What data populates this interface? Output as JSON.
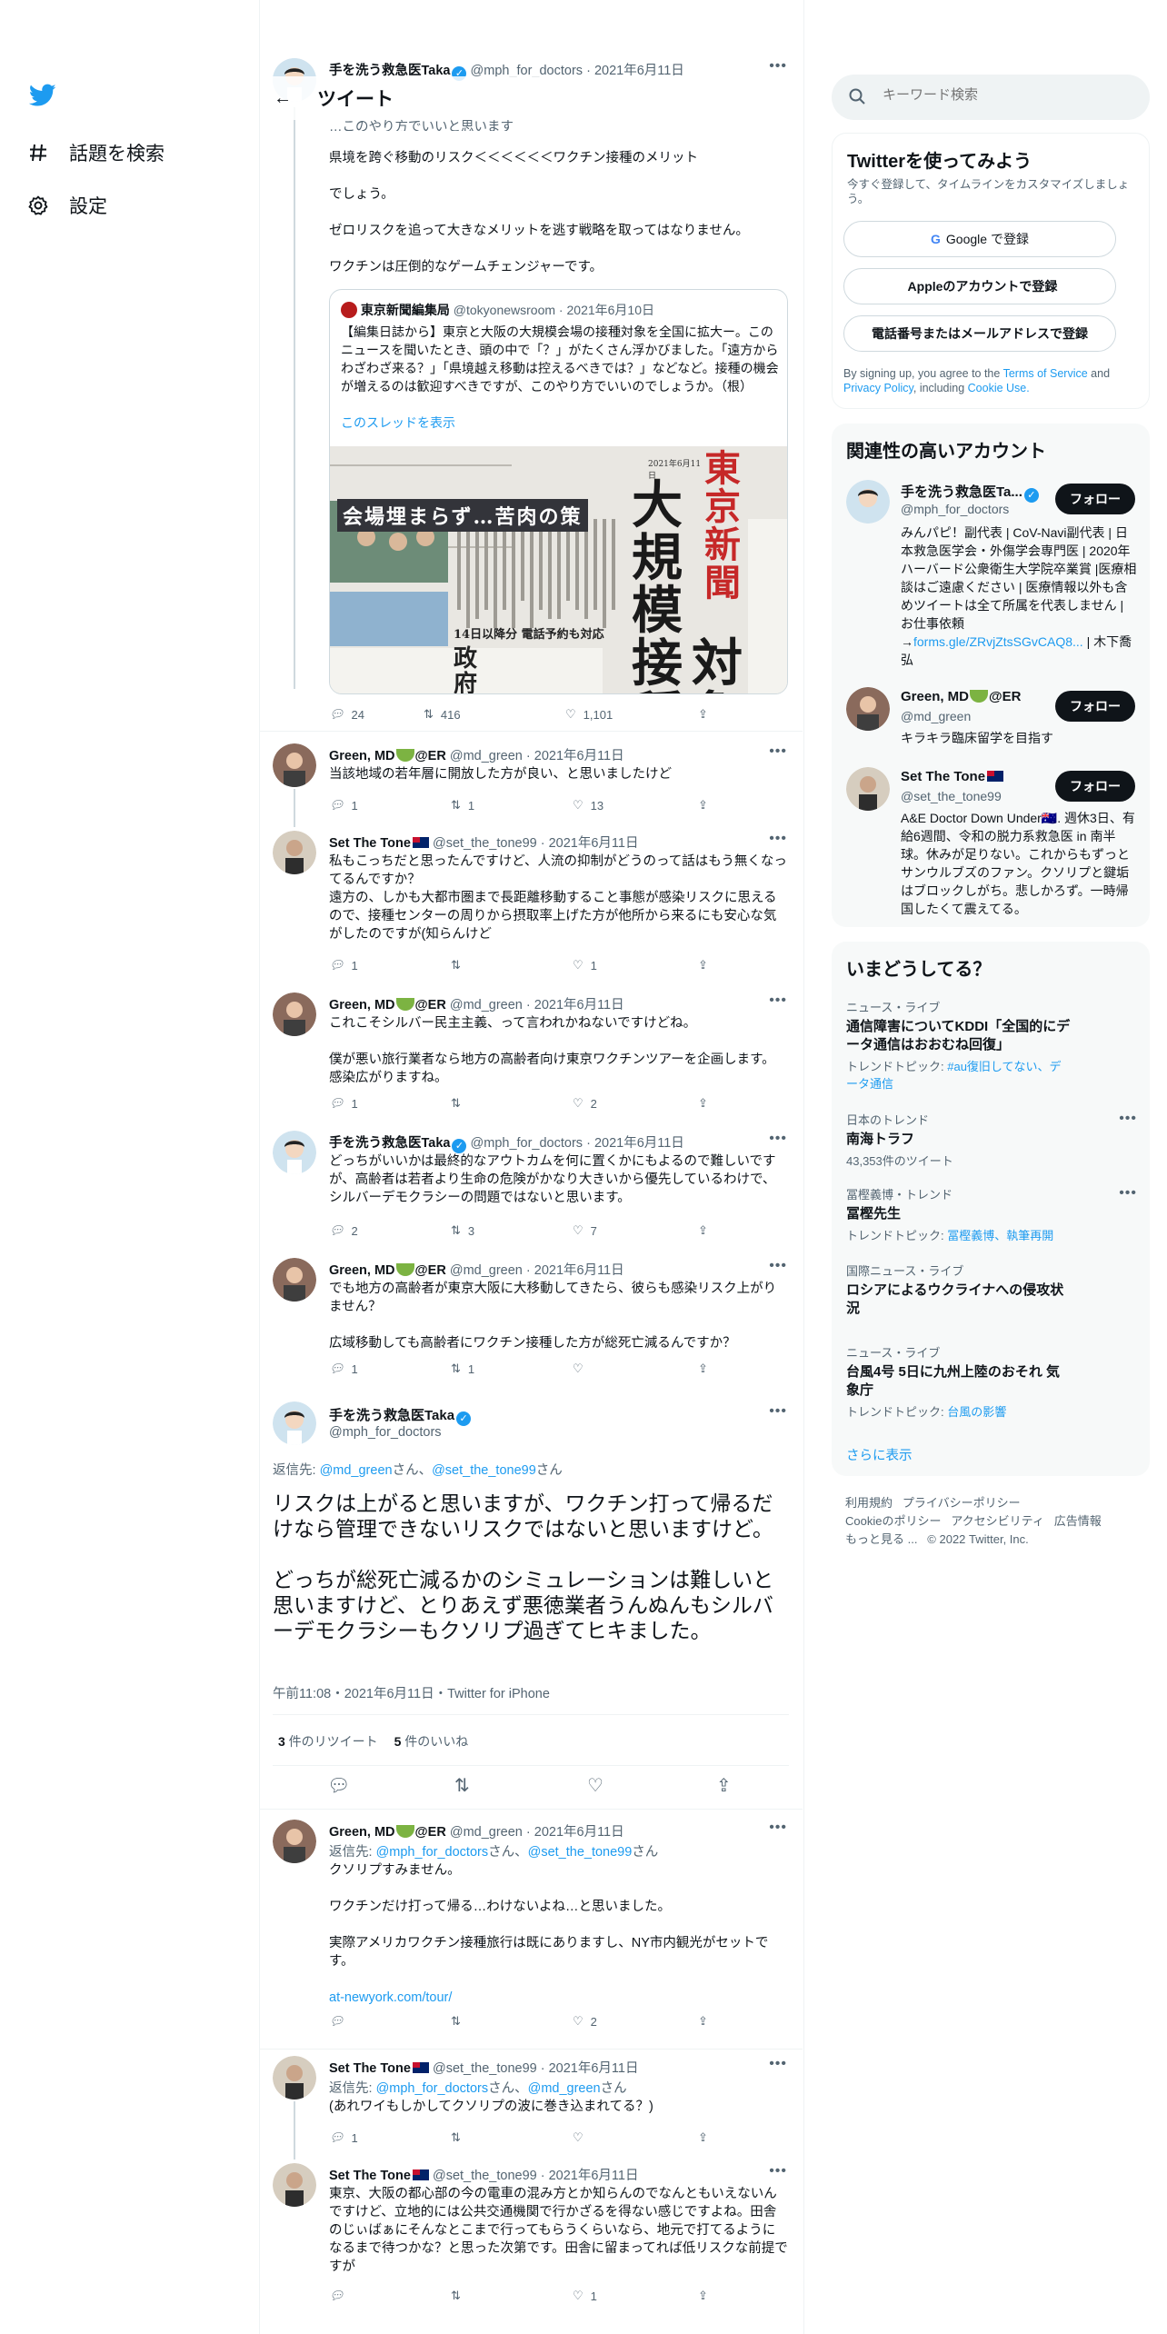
{
  "nav": {
    "explore": "話題を検索",
    "settings": "設定"
  },
  "header": {
    "title": "ツイート"
  },
  "search": {
    "placeholder": "キーワード検索"
  },
  "signup": {
    "title": "Twitterを使ってみよう",
    "subtitle": "今すぐ登録して、タイムラインをカスタマイズしましょう。",
    "google": "Google で登録",
    "apple": "Appleのアカウントで登録",
    "phone": "電話番号またはメールアドレスで登録",
    "terms_pre": "By signing up, you agree to the ",
    "terms_link": "Terms of Service",
    "terms_mid": " and ",
    "privacy_link": "Privacy Policy",
    "terms_mid2": ", including ",
    "cookie_link": "Cookie Use."
  },
  "related": {
    "title": "関連性の高いアカウント",
    "follow": "フォロー",
    "accounts": [
      {
        "name": "手を洗う救急医Ta...",
        "handle": "@mph_for_doctors",
        "bio": "みんパピ！副代表 | CoV-Navi副代表 | 日本救急医学会・外傷学会専門医 | 2020年ハーバード公衆衛生大学院卒業賞 |医療相談はご遠慮ください | 医療情報以外も含めツイートは全て所属を代表しません | お仕事依頼→",
        "bio_link": "forms.gle/ZRvjZtsSGvCAQ8...",
        "bio_end": " | 木下喬弘"
      },
      {
        "name": "Green, MD",
        "name2": "@ER",
        "handle": "@md_green",
        "bio": "キラキラ臨床留学を目指す"
      },
      {
        "name": "Set The Tone",
        "handle": "@set_the_tone99",
        "bio": "A&E Doctor Down Under🇦🇺. 週休3日、有給6週間、令和の脱力系救急医 in 南半球。休みが足りない。これからもずっとサンウルブズのファン。クソリプと鍵垢はブロックしがち。悲しかろず。一時帰国したくて震えてる。"
      }
    ]
  },
  "trends": {
    "title": "いまどうしてる？",
    "items": [
      {
        "cat": "ニュース・ライブ",
        "name": "通信障害についてKDDI「全国的にデータ通信はおおむね回復」",
        "sub_pre": "トレンドトピック: ",
        "sub_link": "#au復旧してない、データ通信"
      },
      {
        "cat": "日本のトレンド",
        "name": "南海トラフ",
        "sub": "43,353件のツイート"
      },
      {
        "cat": "冨樫義博・トレンド",
        "name": "冨樫先生",
        "sub_pre": "トレンドトピック: ",
        "sub_link": "冨樫義博、執筆再開"
      },
      {
        "cat": "国際ニュース・ライブ",
        "name": "ロシアによるウクライナへの侵攻状況"
      },
      {
        "cat": "ニュース・ライブ",
        "name": "台風4号 5日に九州上陸のおそれ 気象庁",
        "sub_pre": "トレンドトピック: ",
        "sub_link": "台風の影響"
      }
    ],
    "show_more": "さらに表示"
  },
  "footer": {
    "l1": "利用規約",
    "l2": "プライバシーポリシー",
    "l3": "Cookieのポリシー",
    "l4": "アクセシビリティ",
    "l5": "広告情報",
    "l6": "もっと見る ...",
    "copy": "© 2022 Twitter, Inc."
  },
  "top_tweet": {
    "name": "手を洗う救急医Taka",
    "handle": "@mph_for_doctors",
    "date": "2021年6月11日",
    "partial": "…このやり方でいいと思います",
    "text": "県境を跨ぐ移動のリスク＜＜＜＜＜＜ワクチン接種のメリット\n\nでしょう。\n\nゼロリスクを追って大きなメリットを逃す戦略を取ってはなりません。\n\nワクチンは圧倒的なゲームチェンジャーです。",
    "quote": {
      "name": "東京新聞編集局",
      "handle": "@tokyonewsroom",
      "date": "2021年6月10日",
      "text": "【編集日誌から】東京と大阪の大規模会場の接種対象を全国に拡大ー。このニュースを聞いたとき、頭の中で「？」がたくさん浮かびました。「遠方からわざわざ来る？」「県境越え移動は控えるべきでは？」などなど。接種の機会が増えるのは歓迎すべきですが、このやり方でいいのでしょうか。（根）",
      "thread": "このスレッドを表示",
      "paper_name": "東京新聞",
      "headline1": "大規模接種",
      "headline2": "対象",
      "sub1": "会場埋まらず…苦肉の策",
      "sub2": "14日以降分 電話予約も対応",
      "sub3": "政府見込",
      "date_stamp": "2021年6月11日"
    },
    "replies": "24",
    "retweets": "416",
    "likes": "1,101"
  },
  "tweets": [
    {
      "name": "Green, MD",
      "name2": "@ER",
      "handle": "@md_green",
      "date": "2021年6月11日",
      "text": "当該地域の若年層に開放した方が良い、と思いましたけど",
      "replies": "1",
      "retweets": "1",
      "likes": "13"
    },
    {
      "name": "Set The Tone",
      "handle": "@set_the_tone99",
      "date": "2021年6月11日",
      "text": "私もこっちだと思ったんですけど、人流の抑制がどうのって話はもう無くなってるんですか？\n遠方の、しかも大都市圏まで長距離移動すること事態が感染リスクに思えるので、接種センターの周りから摂取率上げた方が他所から来るにも安心な気がしたのですが(知らんけど",
      "replies": "1",
      "retweets": "",
      "likes": "1"
    },
    {
      "name": "Green, MD",
      "name2": "@ER",
      "handle": "@md_green",
      "date": "2021年6月11日",
      "text": "これこそシルバー民主主義、って言われかねないですけどね。\n\n僕が悪い旅行業者なら地方の高齢者向け東京ワクチンツアーを企画します。感染広がりますね。",
      "replies": "1",
      "retweets": "",
      "likes": "2"
    },
    {
      "name": "手を洗う救急医Taka",
      "handle": "@mph_for_doctors",
      "date": "2021年6月11日",
      "text": "どっちがいいかは最終的なアウトカムを何に置くかにもよるので難しいですが、高齢者は若者より生命の危険がかなり大きいから優先しているわけで、シルバーデモクラシーの問題ではないと思います。",
      "replies": "2",
      "retweets": "3",
      "likes": "7"
    },
    {
      "name": "Green, MD",
      "name2": "@ER",
      "handle": "@md_green",
      "date": "2021年6月11日",
      "text": "でも地方の高齢者が東京大阪に大移動してきたら、彼らも感染リスク上がりません？\n\n広域移動しても高齢者にワクチン接種した方が総死亡減るんですか？",
      "replies": "1",
      "retweets": "1",
      "likes": ""
    }
  ],
  "main": {
    "name": "手を洗う救急医Taka",
    "handle": "@mph_for_doctors",
    "reply_to_pre": "返信先: ",
    "reply_to_1": "@md_green",
    "reply_to_mid": "さん、",
    "reply_to_2": "@set_the_tone99",
    "reply_to_post": "さん",
    "text": "リスクは上がると思いますが、ワクチン打って帰るだけなら管理できないリスクではないと思いますけど。\n\nどっちが総死亡減るかのシミュレーションは難しいと思いますけど、とりあえず悪徳業者うんぬんもシルバーデモクラシーもクソリプ過ぎてヒキました。",
    "meta": "午前11:08・2021年6月11日・Twitter for iPhone",
    "retweets": "3",
    "retweets_label": " 件のリツイート",
    "likes": "5",
    "likes_label": " 件のいいね"
  },
  "replies": [
    {
      "name": "Green, MD",
      "name2": "@ER",
      "handle": "@md_green",
      "date": "2021年6月11日",
      "rt_pre": "返信先: ",
      "rt1": "@mph_for_doctors",
      "rt_mid": "さん、",
      "rt2": "@set_the_tone99",
      "rt_post": "さん",
      "text": "クソリプすみません。\n\nワクチンだけ打って帰る…わけないよね…と思いました。\n\n実際アメリカワクチン接種旅行は既にありますし、NY市内観光がセットです。",
      "link": "at-newyork.com/tour/",
      "replies": "",
      "retweets": "",
      "likes": "2"
    },
    {
      "name": "Set The Tone",
      "handle": "@set_the_tone99",
      "date": "2021年6月11日",
      "rt_pre": "返信先: ",
      "rt1": "@mph_for_doctors",
      "rt_mid": "さん、",
      "rt2": "@md_green",
      "rt_post": "さん",
      "text": "(あれワイもしかしてクソリプの波に巻き込まれてる？)",
      "replies": "1",
      "retweets": "",
      "likes": ""
    },
    {
      "name": "Set The Tone",
      "handle": "@set_the_tone99",
      "date": "2021年6月11日",
      "text": "東京、大阪の都心部の今の電車の混み方とか知らんのでなんともいえないんですけど、立地的には公共交通機関で行かざるを得ない感じですよね。田舎のじぃばぁにそんなとこまで行ってもらうくらいなら、地元で打てるようになるまで待つかな？と思った次第です。田舎に留まってれば低リスクな前提ですが",
      "replies": "",
      "retweets": "",
      "likes": "1"
    }
  ],
  "colors": {
    "accent": "#1d9bf0",
    "text": "#0f1419",
    "muted": "#536471",
    "border": "#eff3f4"
  }
}
